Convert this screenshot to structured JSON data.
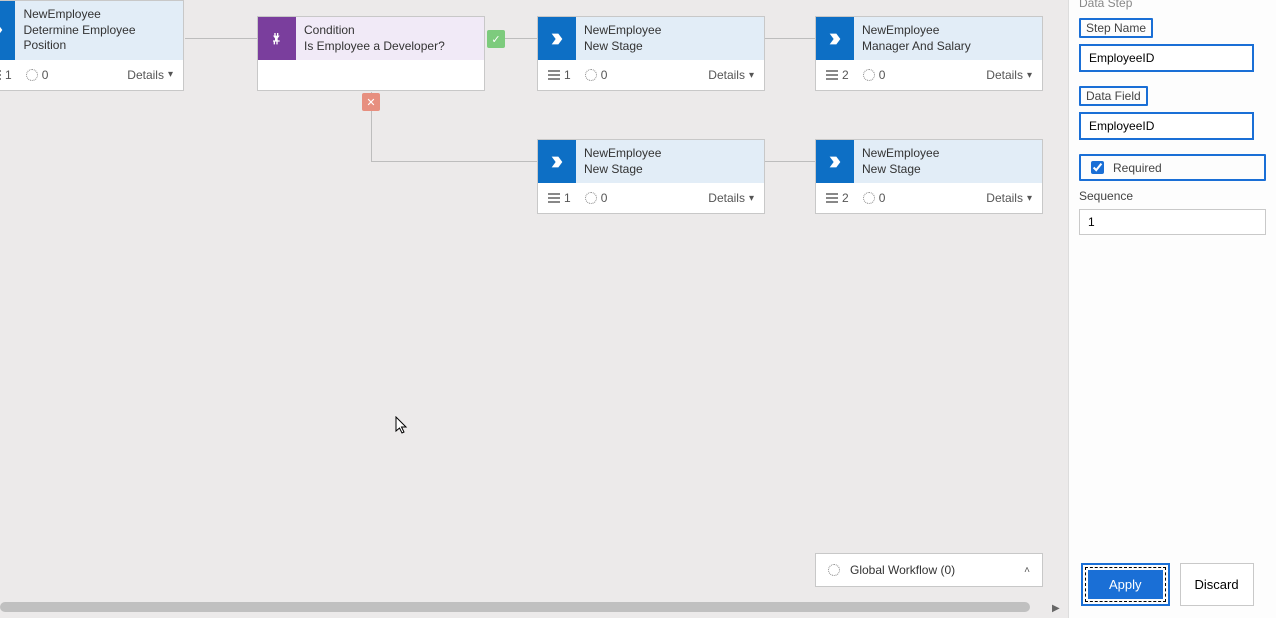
{
  "nodes": {
    "n0": {
      "entity": "NewEmployee",
      "name": "Determine Employee Position",
      "steps": "1",
      "loops": "0",
      "details": "Details"
    },
    "n1": {
      "entity": "Condition",
      "name": "Is Employee a Developer?"
    },
    "n2": {
      "entity": "NewEmployee",
      "name": "New Stage",
      "steps": "1",
      "loops": "0",
      "details": "Details"
    },
    "n3": {
      "entity": "NewEmployee",
      "name": "Manager And Salary",
      "steps": "2",
      "loops": "0",
      "details": "Details"
    },
    "n4": {
      "entity": "NewEmployee",
      "name": "New Stage",
      "steps": "1",
      "loops": "0",
      "details": "Details"
    },
    "n5": {
      "entity": "NewEmployee",
      "name": "New Stage",
      "steps": "2",
      "loops": "0",
      "details": "Details"
    }
  },
  "global_workflow": {
    "label": "Global Workflow (0)"
  },
  "panel": {
    "header": "Data Step",
    "step_name_label": "Step Name",
    "step_name_value": "EmployeeID",
    "data_field_label": "Data Field",
    "data_field_value": "EmployeeID",
    "required_label": "Required",
    "sequence_label": "Sequence",
    "sequence_value": "1",
    "apply_label": "Apply",
    "discard_label": "Discard"
  },
  "colors": {
    "highlight": "#1a6fd6",
    "stage_icon": "#0d6fc5",
    "condition_icon": "#7a3e9d",
    "yes_badge": "#7dcb7d",
    "no_badge": "#e78f7f"
  }
}
